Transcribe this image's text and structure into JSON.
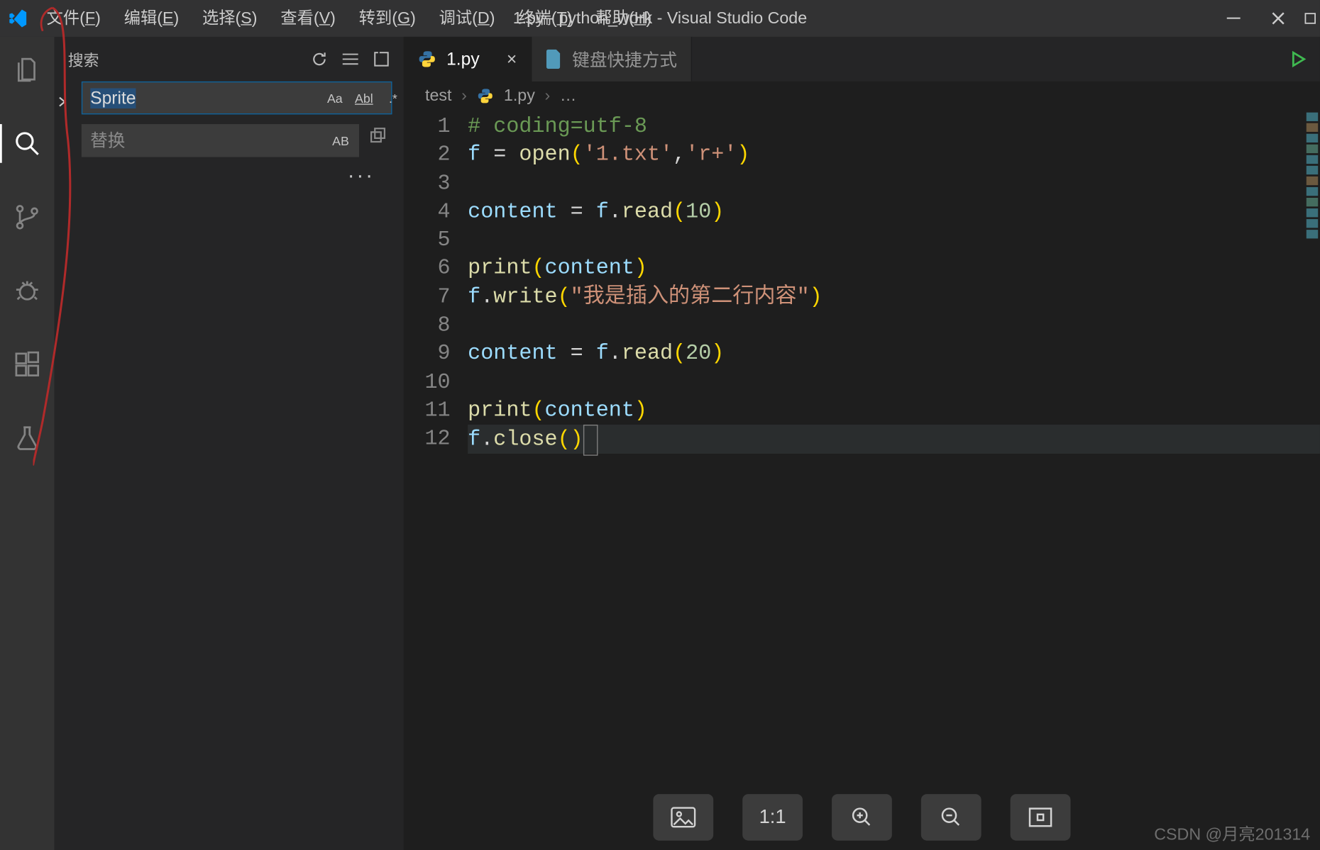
{
  "titlebar": {
    "title": "1.py - python_work - Visual Studio Code",
    "menu": [
      {
        "label": "文件",
        "mn": "F"
      },
      {
        "label": "编辑",
        "mn": "E"
      },
      {
        "label": "选择",
        "mn": "S"
      },
      {
        "label": "查看",
        "mn": "V"
      },
      {
        "label": "转到",
        "mn": "G"
      },
      {
        "label": "调试",
        "mn": "D"
      },
      {
        "label": "终端",
        "mn": "T"
      },
      {
        "label": "帮助",
        "mn": "H"
      }
    ]
  },
  "activitybar": {
    "items": [
      {
        "name": "explorer",
        "icon": "files-icon",
        "active": false
      },
      {
        "name": "search",
        "icon": "search-icon",
        "active": true
      },
      {
        "name": "scm",
        "icon": "branch-icon",
        "active": false
      },
      {
        "name": "debug",
        "icon": "bug-icon",
        "active": false
      },
      {
        "name": "extensions",
        "icon": "extensions-icon",
        "active": false
      },
      {
        "name": "test",
        "icon": "flask-icon",
        "active": false
      }
    ]
  },
  "sidebar": {
    "title": "搜索",
    "actions": {
      "refresh": "refresh-icon",
      "clear": "clear-icon",
      "newfile": "newfile-icon"
    },
    "search_value": "Sprite",
    "match_case": "Aa",
    "whole_word": "Abl",
    "regex": ".*",
    "replace_placeholder": "替换",
    "replace_all_label": "AB",
    "ellipsis": "···"
  },
  "tabs": [
    {
      "label": "1.py",
      "icon": "python-icon",
      "active": true,
      "closeable": true
    },
    {
      "label": "键盘快捷方式",
      "icon": "file-icon",
      "active": false,
      "closeable": false
    }
  ],
  "breadcrumbs": {
    "folder": "test",
    "file": "1.py",
    "more": "…"
  },
  "code": {
    "lines": [
      {
        "n": 1,
        "seg": [
          {
            "t": "# coding=utf-8",
            "c": "cmt"
          }
        ]
      },
      {
        "n": 2,
        "seg": [
          {
            "t": "f",
            "c": "var"
          },
          {
            "t": " = ",
            "c": "op"
          },
          {
            "t": "open",
            "c": "fn"
          },
          {
            "t": "(",
            "c": "par"
          },
          {
            "t": "'1.txt'",
            "c": "str"
          },
          {
            "t": ",",
            "c": "pn"
          },
          {
            "t": "'r+'",
            "c": "str"
          },
          {
            "t": ")",
            "c": "par"
          }
        ]
      },
      {
        "n": 3,
        "seg": []
      },
      {
        "n": 4,
        "seg": [
          {
            "t": "content",
            "c": "var"
          },
          {
            "t": " = ",
            "c": "op"
          },
          {
            "t": "f",
            "c": "var"
          },
          {
            "t": ".",
            "c": "pn"
          },
          {
            "t": "read",
            "c": "fn"
          },
          {
            "t": "(",
            "c": "par"
          },
          {
            "t": "10",
            "c": "num"
          },
          {
            "t": ")",
            "c": "par"
          }
        ]
      },
      {
        "n": 5,
        "seg": []
      },
      {
        "n": 6,
        "seg": [
          {
            "t": "print",
            "c": "fn"
          },
          {
            "t": "(",
            "c": "par"
          },
          {
            "t": "content",
            "c": "var"
          },
          {
            "t": ")",
            "c": "par"
          }
        ]
      },
      {
        "n": 7,
        "seg": [
          {
            "t": "f",
            "c": "var"
          },
          {
            "t": ".",
            "c": "pn"
          },
          {
            "t": "write",
            "c": "fn"
          },
          {
            "t": "(",
            "c": "par"
          },
          {
            "t": "\"我是插入的第二行内容\"",
            "c": "str"
          },
          {
            "t": ")",
            "c": "par"
          }
        ]
      },
      {
        "n": 8,
        "seg": []
      },
      {
        "n": 9,
        "seg": [
          {
            "t": "content",
            "c": "var"
          },
          {
            "t": " = ",
            "c": "op"
          },
          {
            "t": "f",
            "c": "var"
          },
          {
            "t": ".",
            "c": "pn"
          },
          {
            "t": "read",
            "c": "fn"
          },
          {
            "t": "(",
            "c": "par"
          },
          {
            "t": "20",
            "c": "num"
          },
          {
            "t": ")",
            "c": "par"
          }
        ]
      },
      {
        "n": 10,
        "seg": []
      },
      {
        "n": 11,
        "seg": [
          {
            "t": "print",
            "c": "fn"
          },
          {
            "t": "(",
            "c": "par"
          },
          {
            "t": "content",
            "c": "var"
          },
          {
            "t": ")",
            "c": "par"
          }
        ]
      },
      {
        "n": 12,
        "current": true,
        "seg": [
          {
            "t": "f",
            "c": "var"
          },
          {
            "t": ".",
            "c": "pn"
          },
          {
            "t": "close",
            "c": "fn"
          },
          {
            "t": "(",
            "c": "par"
          },
          {
            "t": ")",
            "c": "par"
          }
        ]
      }
    ]
  },
  "img_toolbar": {
    "ratio_label": "1:1"
  },
  "watermark": "CSDN @月亮201314"
}
